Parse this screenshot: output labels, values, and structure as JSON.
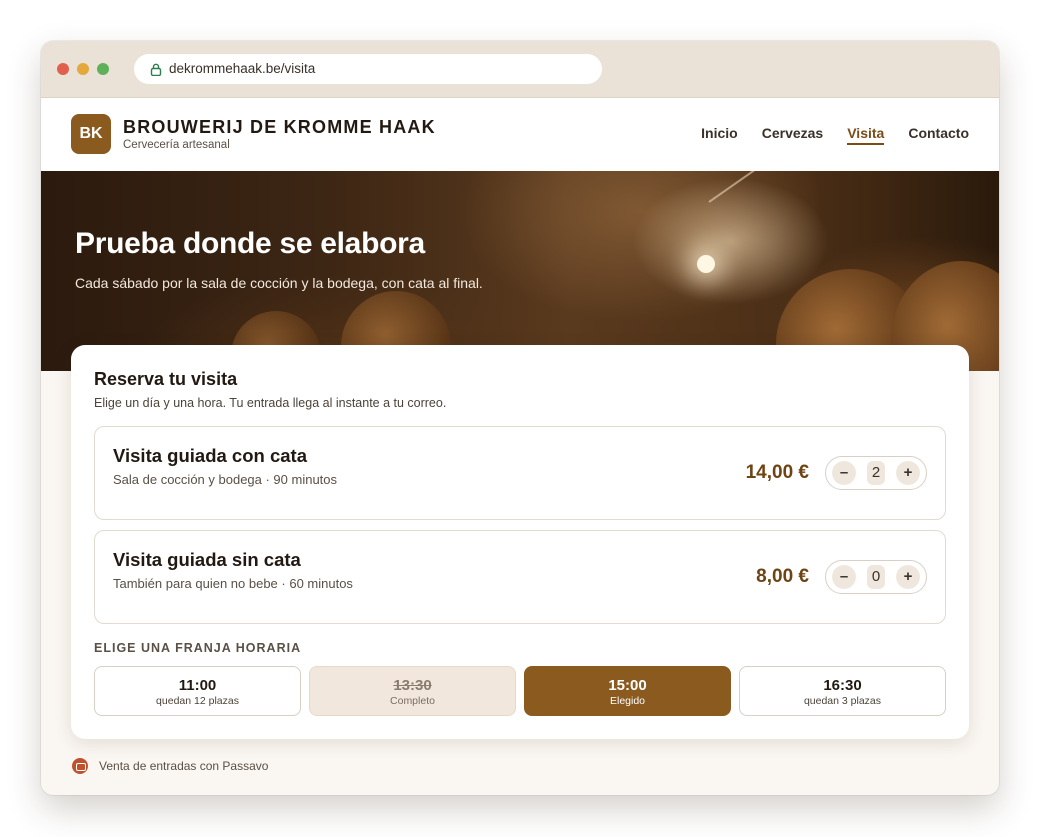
{
  "browser": {
    "url": "dekrommehaak.be/visita"
  },
  "header": {
    "logo_initials": "BK",
    "brand_name": "BROUWERIJ DE KROMME HAAK",
    "brand_tagline": "Cervecería artesanal",
    "nav": [
      {
        "label": "Inicio",
        "active": false
      },
      {
        "label": "Cervezas",
        "active": false
      },
      {
        "label": "Visita",
        "active": true
      },
      {
        "label": "Contacto",
        "active": false
      }
    ]
  },
  "hero": {
    "title": "Prueba donde se elabora",
    "subtitle": "Cada sábado por la sala de cocción y la bodega, con cata al final."
  },
  "booking": {
    "title": "Reserva tu visita",
    "subtitle": "Elige un día y una hora. Tu entrada llega al instante a tu correo.",
    "tickets": [
      {
        "name": "Visita guiada con cata",
        "description": "Sala de cocción y bodega · 90 minutos",
        "price": "14,00 €",
        "quantity": "2",
        "minus": "–",
        "plus": "+"
      },
      {
        "name": "Visita guiada sin cata",
        "description": "También para quien no bebe · 60 minutos",
        "price": "8,00 €",
        "quantity": "0",
        "minus": "–",
        "plus": "+"
      }
    ],
    "slots_title": "ELIGE UNA FRANJA HORARIA",
    "slots": [
      {
        "time": "11:00",
        "note": "quedan 12 plazas",
        "state": "available"
      },
      {
        "time": "13:30",
        "note": "Completo",
        "state": "full"
      },
      {
        "time": "15:00",
        "note": "Elegido",
        "state": "selected"
      },
      {
        "time": "16:30",
        "note": "quedan 3 plazas",
        "state": "available"
      }
    ]
  },
  "footer": {
    "text": "Venta de entradas con Passavo"
  },
  "colors": {
    "accent": "#8a5a1f",
    "price": "#6e4414",
    "footer_icon": "#c0512f"
  }
}
